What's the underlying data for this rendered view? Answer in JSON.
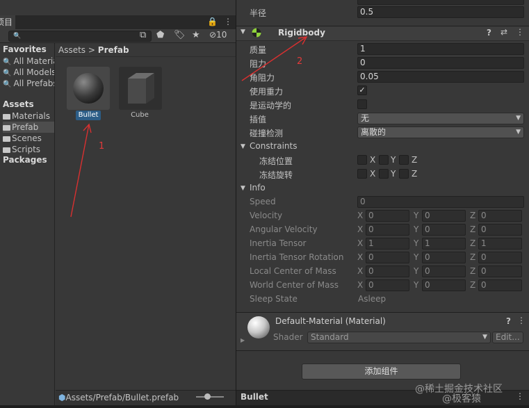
{
  "project": {
    "tab_label": "项目",
    "menu_icons": [
      "lock-icon",
      "more-vert-icon"
    ],
    "search": {
      "value": "",
      "search_icon": "🔍"
    },
    "tools": {
      "hidden_count": "10"
    },
    "tree": {
      "favorites_header": "Favorites",
      "favorites": [
        "All Materials",
        "All Models",
        "All Prefabs"
      ],
      "assets_header": "Assets",
      "folders": [
        "Materials",
        "Prefab",
        "Scenes",
        "Scripts"
      ],
      "packages_header": "Packages"
    },
    "breadcrumb": {
      "root": "Assets",
      "separator": ">",
      "current": "Prefab"
    },
    "assets": [
      {
        "label": "Bullet",
        "selected": true
      },
      {
        "label": "Cube",
        "selected": false
      }
    ],
    "footer_path": "Assets/Prefab/Bullet.prefab"
  },
  "inspector": {
    "top": {
      "label": "半径",
      "value": "0.5"
    },
    "rigidbody": {
      "title": "Rigidbody",
      "mass": {
        "label": "质量",
        "value": "1"
      },
      "drag": {
        "label": "阻力",
        "value": "0"
      },
      "angular_drag": {
        "label": "角阻力",
        "value": "0.05"
      },
      "use_gravity": {
        "label": "使用重力",
        "checked": true,
        "mark": "✓"
      },
      "is_kinematic": {
        "label": "是运动学的",
        "checked": false
      },
      "interpolate": {
        "label": "插值",
        "value": "无"
      },
      "collision": {
        "label": "碰撞检测",
        "value": "离散的"
      },
      "constraints": {
        "title": "Constraints",
        "freeze_position": "冻结位置",
        "freeze_rotation": "冻结旋转",
        "axes": [
          "X",
          "Y",
          "Z"
        ]
      },
      "info": {
        "title": "Info",
        "speed": {
          "label": "Speed",
          "value": "0"
        },
        "vectors": [
          {
            "label": "Velocity",
            "x": "0",
            "y": "0",
            "z": "0"
          },
          {
            "label": "Angular Velocity",
            "x": "0",
            "y": "0",
            "z": "0"
          },
          {
            "label": "Inertia Tensor",
            "x": "1",
            "y": "1",
            "z": "1"
          },
          {
            "label": "Inertia Tensor Rotation",
            "x": "0",
            "y": "0",
            "z": "0"
          },
          {
            "label": "Local Center of Mass",
            "x": "0",
            "y": "0",
            "z": "0"
          },
          {
            "label": "World Center of Mass",
            "x": "0",
            "y": "0",
            "z": "0"
          }
        ],
        "sleep_state": {
          "label": "Sleep State",
          "value": "Asleep"
        }
      }
    },
    "material": {
      "name": "Default-Material (Material)",
      "shader_label": "Shader",
      "shader_value": "Standard",
      "edit_label": "Edit..."
    },
    "add_component": "添加组件",
    "preview_title": "Bullet"
  },
  "annotations": {
    "arrow1": "1",
    "arrow2": "2"
  },
  "watermark": {
    "line1": "@稀土掘金技术社区",
    "line2": "@极客猿"
  }
}
